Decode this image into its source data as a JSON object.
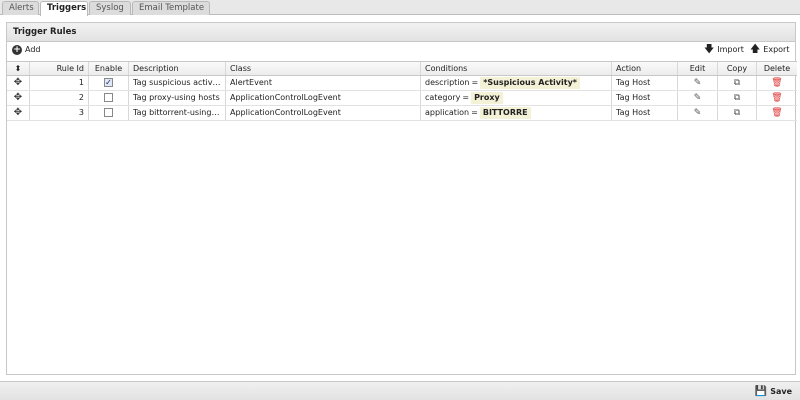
{
  "tabs": [
    {
      "label": "Alerts"
    },
    {
      "label": "Triggers"
    },
    {
      "label": "Syslog"
    },
    {
      "label": "Email Template"
    }
  ],
  "panel": {
    "title": "Trigger Rules",
    "add_label": "Add",
    "import_label": "Import",
    "export_label": "Export"
  },
  "columns": {
    "rule_id": "Rule Id",
    "enable": "Enable",
    "description": "Description",
    "class": "Class",
    "conditions": "Conditions",
    "action": "Action",
    "edit": "Edit",
    "copy": "Copy",
    "delete": "Delete"
  },
  "rows": [
    {
      "rule_id": "1",
      "enabled": true,
      "description": "Tag suspicious activity",
      "class": "AlertEvent",
      "cond_field": "description",
      "cond_op": "=",
      "cond_value": "*Suspicious Activity*",
      "action": "Tag Host"
    },
    {
      "rule_id": "2",
      "enabled": false,
      "description": "Tag proxy-using hosts",
      "class": "ApplicationControlLogEvent",
      "cond_field": "category",
      "cond_op": "=",
      "cond_value": "Proxy",
      "action": "Tag Host"
    },
    {
      "rule_id": "3",
      "enabled": false,
      "description": "Tag bittorrent-using h...",
      "class": "ApplicationControlLogEvent",
      "cond_field": "application",
      "cond_op": "=",
      "cond_value": "BITTORRE",
      "action": "Tag Host"
    }
  ],
  "footer": {
    "save_label": "Save"
  },
  "colors": {
    "delete": "#dd3333",
    "condition_bg": "#f3f1d6"
  }
}
